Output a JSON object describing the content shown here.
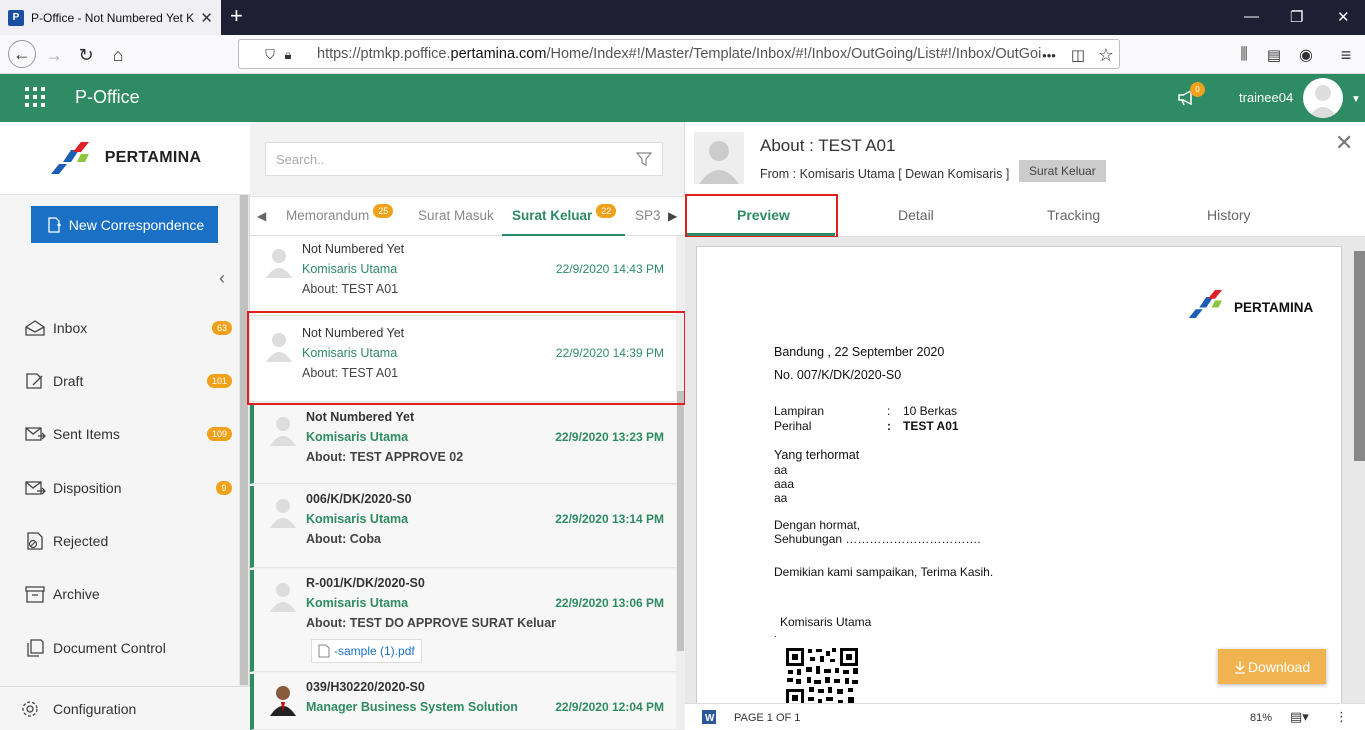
{
  "browser": {
    "tab_title": "P-Office - Not Numbered Yet K",
    "url_prefix": "https://ptmkp.poffice.",
    "url_domain": "pertamina.com",
    "url_path": "/Home/Index#!/Master/Template/Inbox/#!/Inbox/OutGoing/List#!/Inbox/OutGoi",
    "url_more": "•••"
  },
  "app": {
    "name": "P-Office",
    "notification_count": "0",
    "username": "trainee04"
  },
  "sidebar": {
    "logo_text": "PERTAMINA",
    "new_button": "New Correspondence",
    "items": [
      {
        "label": "Inbox",
        "badge": "63",
        "icon": "inbox-icon"
      },
      {
        "label": "Draft",
        "badge": "101",
        "icon": "draft-icon"
      },
      {
        "label": "Sent Items",
        "badge": "109",
        "icon": "sent-icon"
      },
      {
        "label": "Disposition",
        "badge": "9",
        "icon": "disposition-icon"
      },
      {
        "label": "Rejected",
        "badge": "",
        "icon": "rejected-icon"
      },
      {
        "label": "Archive",
        "badge": "",
        "icon": "archive-icon"
      },
      {
        "label": "Document Control",
        "badge": "",
        "icon": "document-control-icon"
      }
    ],
    "config": "Configuration"
  },
  "list": {
    "search_placeholder": "Search..",
    "tabs": [
      {
        "label": "Memorandum",
        "badge": "25"
      },
      {
        "label": "Surat Masuk",
        "badge": ""
      },
      {
        "label": "Surat Keluar",
        "badge": "22"
      },
      {
        "label": "SP3",
        "badge": ""
      }
    ],
    "items": [
      {
        "number": "Not Numbered Yet",
        "from": "Komisaris Utama",
        "about": "About: TEST A01",
        "time": "22/9/2020 14:43 PM"
      },
      {
        "number": "Not Numbered Yet",
        "from": "Komisaris Utama",
        "about": "About: TEST A01",
        "time": "22/9/2020 14:39 PM"
      },
      {
        "number": "Not Numbered Yet",
        "from": "Komisaris Utama",
        "about": "About: TEST APPROVE 02",
        "time": "22/9/2020 13:23 PM"
      },
      {
        "number": "006/K/DK/2020-S0",
        "from": "Komisaris Utama",
        "about": "About: Coba",
        "time": "22/9/2020 13:14 PM"
      },
      {
        "number": "R-001/K/DK/2020-S0",
        "from": "Komisaris Utama",
        "about": "About: TEST DO APPROVE SURAT Keluar",
        "time": "22/9/2020 13:06 PM",
        "attachment": "-sample (1).pdf"
      },
      {
        "number": "039/H30220/2020-S0",
        "from": "Manager Business System Solution",
        "about": "",
        "time": "22/9/2020 12:04 PM"
      }
    ]
  },
  "detail": {
    "title": "About : TEST A01",
    "from": "From : Komisaris Utama [ Dewan Komisaris ]",
    "tag": "Surat Keluar",
    "tabs": [
      "Preview",
      "Detail",
      "Tracking",
      "History"
    ],
    "letter": {
      "logo_text": "PERTAMINA",
      "place": "Bandung",
      "date": ", 22 September 2020",
      "number": "No. 007/K/DK/2020-S0",
      "lampiran_label": "Lampiran",
      "lampiran_value": "10 Berkas",
      "perihal_label": "Perihal",
      "perihal_value": "TEST A01",
      "colon": ":",
      "greeting": "Yang terhormat",
      "recipients": [
        "aa",
        "aaa",
        "aa"
      ],
      "body1": "Dengan hormat,",
      "body2": "Sehubungan …………………………….",
      "closing": "Demikian kami sampaikan, Terima Kasih.",
      "signer": "Komisaris Utama",
      "dot": "."
    },
    "download": "Download",
    "page_info": "PAGE 1 OF 1",
    "zoom": "81%"
  }
}
